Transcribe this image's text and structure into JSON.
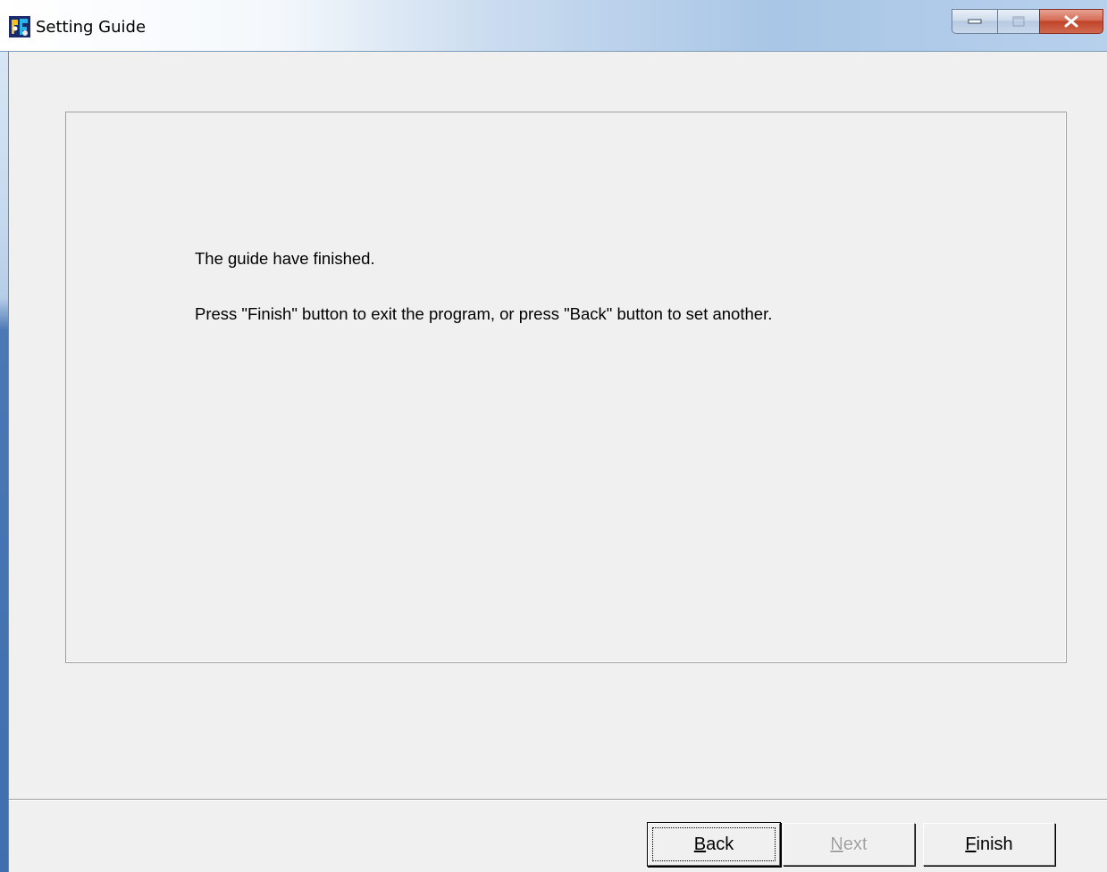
{
  "window": {
    "title": "Setting Guide",
    "app_icon": "app-icon",
    "caption_buttons": [
      "minimize-icon",
      "maximize-icon",
      "close-icon"
    ]
  },
  "content": {
    "line1": "The guide have finished.",
    "line2": "Press \"Finish\" button to exit the program, or press \"Back\" button to set another."
  },
  "buttons": {
    "back": {
      "mnemonic": "B",
      "rest": "ack",
      "enabled": true
    },
    "next": {
      "mnemonic": "N",
      "rest": "ext",
      "enabled": false
    },
    "finish": {
      "mnemonic": "F",
      "rest": "inish",
      "enabled": true
    }
  }
}
